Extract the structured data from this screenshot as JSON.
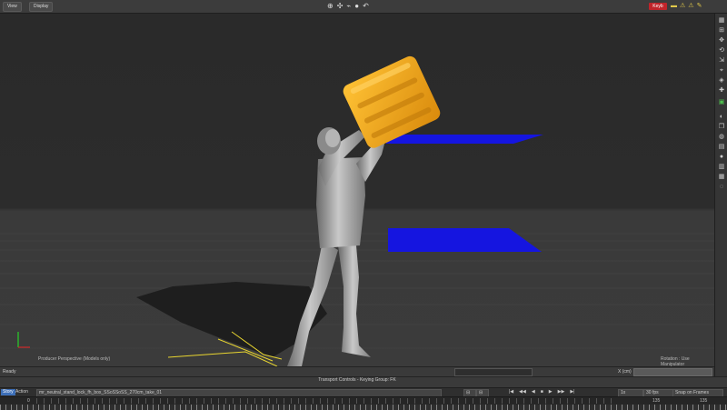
{
  "menu": {
    "view": "View",
    "display": "Display"
  },
  "toolbar": {
    "center_tools": [
      "⊕",
      "✣",
      "⌁",
      "●",
      "↶"
    ],
    "key_label": "Keyb",
    "right_tools": [
      "▬",
      "⚠",
      "⚠",
      "✎"
    ]
  },
  "viewport": {
    "camera_label": "Producer Perspective (Models only)",
    "rotation_label": "Rotation : Use Manipulator"
  },
  "right_toolbar": {
    "icons": [
      "▦",
      "⊞",
      "✥",
      "⟲",
      "⇲",
      "⌖",
      "◈",
      "✚",
      "▣",
      "◐",
      "❐",
      "◍",
      "▤",
      "●",
      "▥",
      "▦",
      "◌"
    ]
  },
  "status": {
    "text": "Ready",
    "x_label": "X (cm)"
  },
  "transport": {
    "title": "Transport Controls  -  Keying Group: FK",
    "left_buttons": [
      "⊟",
      "⊟"
    ],
    "frame": "0",
    "play_controls": [
      "|◀",
      "◀◀",
      "◀",
      "■",
      "▶",
      "▶▶",
      "▶|"
    ],
    "speed": "1x",
    "fps": "30 fps",
    "snap": "Snap on Frames"
  },
  "take": {
    "story_tab": "Story",
    "action_tab": "Action",
    "name": "mr_neutral_stand_lock_fh_box_SSoSSoSS_270cm_take_01",
    "start": "0",
    "end": "135",
    "end2": "135"
  },
  "colors": {
    "box": "#f0a218",
    "box_shadow": "#b8700a",
    "plane": "#1515e0",
    "grid": "#4a4a4a",
    "key_button": "#c0242a"
  }
}
